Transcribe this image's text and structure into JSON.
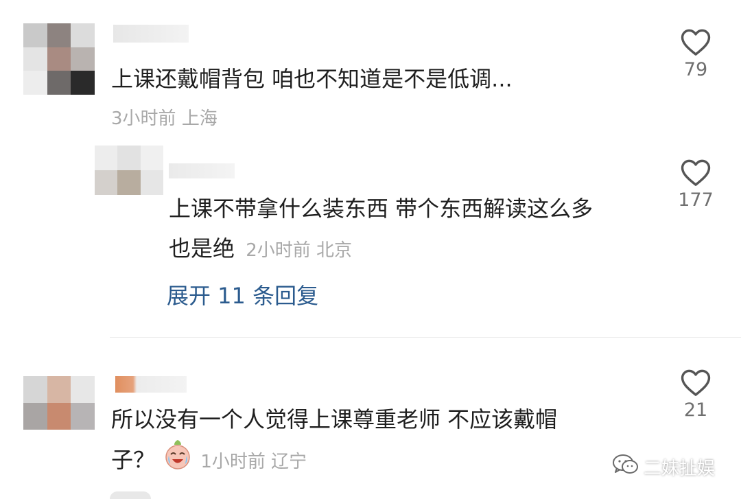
{
  "comments": [
    {
      "text": "上课还戴帽背包 咱也不知道是不是低调...",
      "time": "3小时前",
      "location": "上海",
      "likes": "79"
    },
    {
      "text_line1": "上课不带拿什么装东西 带个东西解读这么多",
      "text_line2": "也是绝",
      "time": "2小时前",
      "location": "北京",
      "likes": "177"
    },
    {
      "text_line1": "所以没有一个人觉得上课尊重老师 不应该戴帽",
      "text_line2": "子？",
      "time": "1小时前",
      "location": "辽宁",
      "likes": "21"
    }
  ],
  "expand_replies": "展开 11 条回复",
  "watermark": "二妹扯娱",
  "icons": {
    "like": "heart-outline-icon",
    "emoji": "crying-laughing-emoji-icon",
    "watermark": "wechat-icon"
  },
  "colors": {
    "text": "#1f1f1f",
    "meta": "#a8a8a8",
    "link": "#2b5b8e",
    "like_count": "#6f6f6f"
  }
}
